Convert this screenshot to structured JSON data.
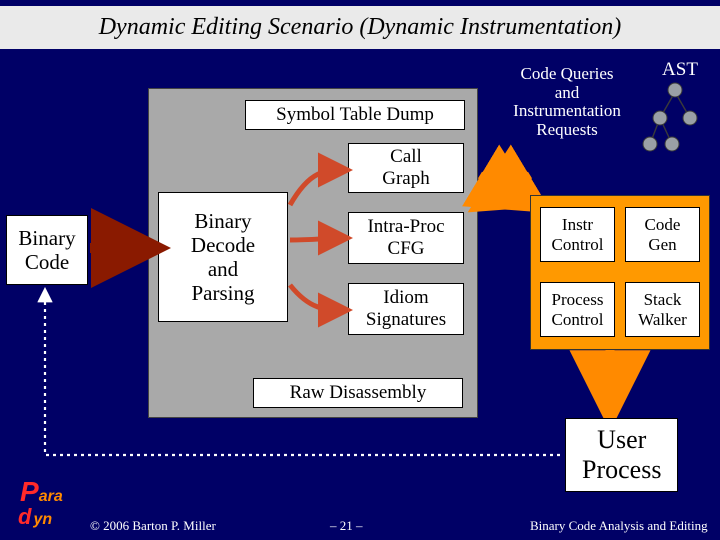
{
  "title": "Dynamic Editing Scenario (Dynamic Instrumentation)",
  "binary_code": "Binary\nCode",
  "gray_panel": {
    "symbol_table_dump": "Symbol Table Dump",
    "binary_decode": "Binary\nDecode\nand\nParsing",
    "call_graph": "Call\nGraph",
    "intra_proc": "Intra-Proc\nCFG",
    "idiom_sig": "Idiom\nSignatures",
    "raw_disassembly": "Raw Disassembly"
  },
  "queries_label": "Code Queries\nand\nInstrumentation\nRequests",
  "ast_label": "AST",
  "orange_panel": {
    "instr_control": "Instr\nControl",
    "code_gen": "Code\nGen",
    "process_control": "Process\nControl",
    "stack_walker": "Stack\nWalker"
  },
  "user_process": "User\nProcess",
  "footer": {
    "copyright": "© 2006 Barton P. Miller",
    "page": "– 21 –",
    "series": "Binary Code Analysis and Editing"
  }
}
